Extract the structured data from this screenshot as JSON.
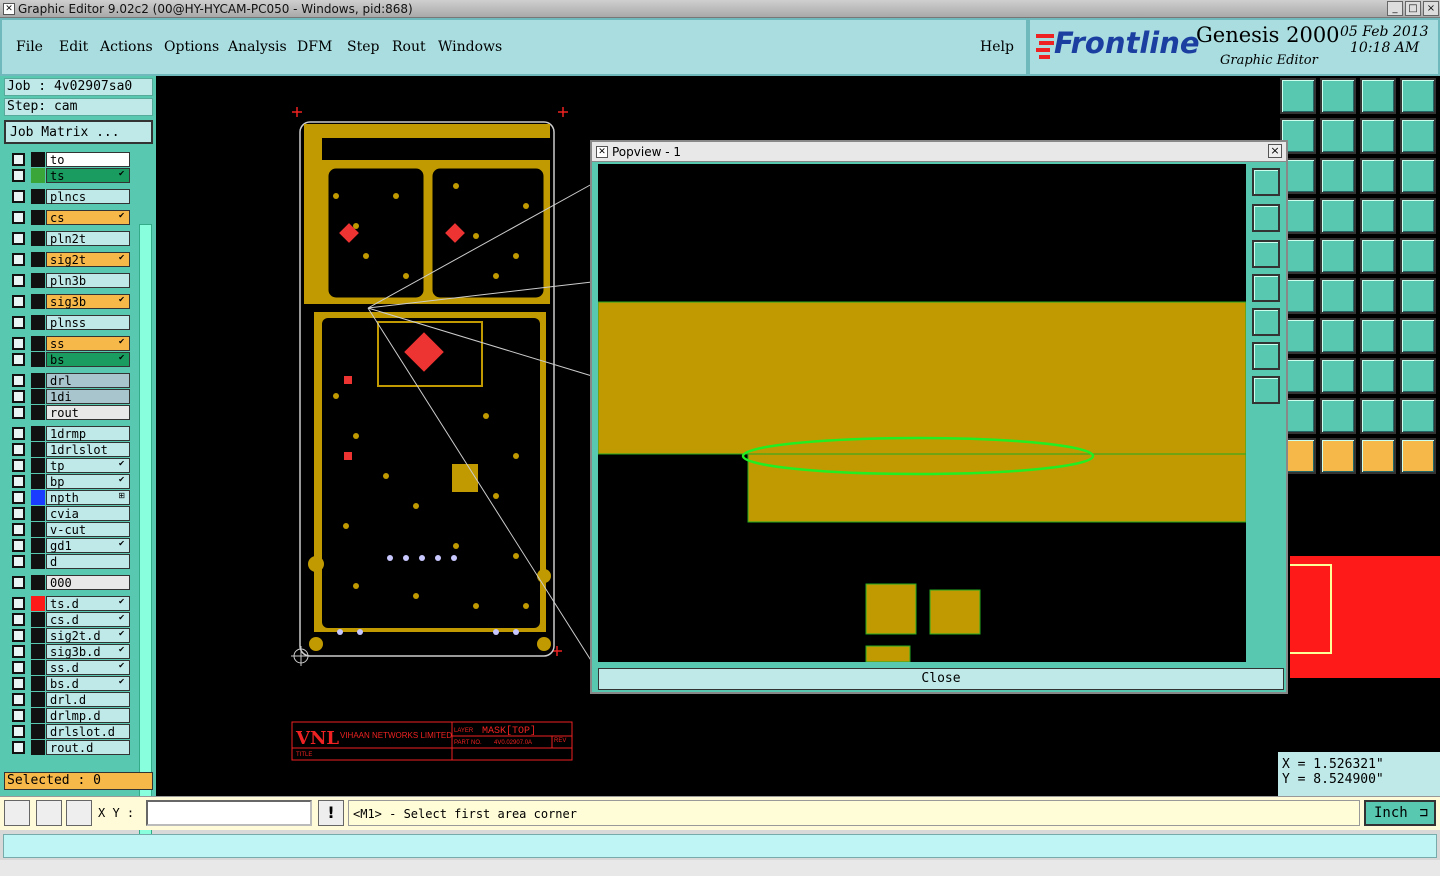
{
  "window": {
    "title": "Graphic Editor 9.02c2 (00@HY-HYCAM-PC050 - Windows, pid:868)"
  },
  "menu": {
    "items": [
      "File",
      "Edit",
      "Actions",
      "Options",
      "Analysis",
      "DFM",
      "Step",
      "Rout",
      "Windows"
    ],
    "help": "Help"
  },
  "brand": {
    "logo": "Frontline",
    "product": "Genesis 2000",
    "subtitle": "Graphic Editor",
    "date": "05 Feb 2013",
    "time": "10:18 AM"
  },
  "job": {
    "job_label": "Job : 4v02907sa0",
    "step_label": "Step: cam",
    "matrix_button": "Job Matrix ..."
  },
  "layers": [
    {
      "name": "to",
      "color": "#ffffff",
      "swatch": "#111111",
      "mark": ""
    },
    {
      "name": "ts",
      "color": "#1a9c60",
      "swatch": "#3aa63a",
      "mark": "✔"
    },
    {
      "name": "plncs",
      "color": "#bfe8e8",
      "swatch": "#111111",
      "mark": ""
    },
    {
      "name": "cs",
      "color": "#f7b84a",
      "swatch": "#111111",
      "mark": "✔"
    },
    {
      "name": "pln2t",
      "color": "#bfe8e8",
      "swatch": "#111111",
      "mark": ""
    },
    {
      "name": "sig2t",
      "color": "#f7b84a",
      "swatch": "#111111",
      "mark": "✔"
    },
    {
      "name": "pln3b",
      "color": "#bfe8e8",
      "swatch": "#111111",
      "mark": ""
    },
    {
      "name": "sig3b",
      "color": "#f7b84a",
      "swatch": "#111111",
      "mark": "✔"
    },
    {
      "name": "plnss",
      "color": "#bfe8e8",
      "swatch": "#111111",
      "mark": ""
    },
    {
      "name": "ss",
      "color": "#f7b84a",
      "swatch": "#111111",
      "mark": "✔"
    },
    {
      "name": "bs",
      "color": "#1a9c60",
      "swatch": "#111111",
      "mark": "✔"
    },
    {
      "name": "drl",
      "color": "#a8c4cc",
      "swatch": "#111111",
      "mark": ""
    },
    {
      "name": "1di",
      "color": "#a8c4cc",
      "swatch": "#111111",
      "mark": ""
    },
    {
      "name": "rout",
      "color": "#e8e8e8",
      "swatch": "#111111",
      "mark": ""
    },
    {
      "name": "1drmp",
      "color": "#bfe8e8",
      "swatch": "#111111",
      "mark": ""
    },
    {
      "name": "1drlslot",
      "color": "#bfe8e8",
      "swatch": "#111111",
      "mark": ""
    },
    {
      "name": "tp",
      "color": "#bfe8e8",
      "swatch": "#111111",
      "mark": "✔"
    },
    {
      "name": "bp",
      "color": "#bfe8e8",
      "swatch": "#111111",
      "mark": "✔"
    },
    {
      "name": "npth",
      "color": "#bfe8e8",
      "swatch": "#1a3cff",
      "mark": "⊞"
    },
    {
      "name": "cvia",
      "color": "#bfe8e8",
      "swatch": "#111111",
      "mark": ""
    },
    {
      "name": "v-cut",
      "color": "#bfe8e8",
      "swatch": "#111111",
      "mark": ""
    },
    {
      "name": "gd1",
      "color": "#bfe8e8",
      "swatch": "#111111",
      "mark": "✔"
    },
    {
      "name": "d",
      "color": "#bfe8e8",
      "swatch": "#111111",
      "mark": ""
    },
    {
      "name": "000",
      "color": "#e8e8e8",
      "swatch": "#111111",
      "mark": ""
    },
    {
      "name": "ts.d",
      "color": "#bfe8e8",
      "swatch": "#ff1a1a",
      "mark": "✔"
    },
    {
      "name": "cs.d",
      "color": "#bfe8e8",
      "swatch": "#111111",
      "mark": "✔"
    },
    {
      "name": "sig2t.d",
      "color": "#bfe8e8",
      "swatch": "#111111",
      "mark": "✔"
    },
    {
      "name": "sig3b.d",
      "color": "#bfe8e8",
      "swatch": "#111111",
      "mark": "✔"
    },
    {
      "name": "ss.d",
      "color": "#bfe8e8",
      "swatch": "#111111",
      "mark": "✔"
    },
    {
      "name": "bs.d",
      "color": "#bfe8e8",
      "swatch": "#111111",
      "mark": "✔"
    },
    {
      "name": "drl.d",
      "color": "#bfe8e8",
      "swatch": "#111111",
      "mark": ""
    },
    {
      "name": "drlmp.d",
      "color": "#bfe8e8",
      "swatch": "#111111",
      "mark": ""
    },
    {
      "name": "drlslot.d",
      "color": "#bfe8e8",
      "swatch": "#111111",
      "mark": ""
    },
    {
      "name": "rout.d",
      "color": "#bfe8e8",
      "swatch": "#111111",
      "mark": ""
    }
  ],
  "selected": "Selected : 0",
  "popview": {
    "title": "Popview - 1",
    "close_label": "Close"
  },
  "coords": {
    "x": "X = 1.526321\"",
    "y": "Y = 8.524900\""
  },
  "status": {
    "xy_label": "X Y :",
    "xy_value": "",
    "prompt": "<M1> - Select first area corner",
    "unit": "Inch"
  },
  "titleblock": {
    "company": "VIHAAN NETWORKS LIMITED",
    "layer_label": "LAYER",
    "layer_value": "MASK[TOP]",
    "part_label": "PART NO.",
    "part_value": "4V0.02907.0A",
    "rev_label": "REV",
    "title_label": "TITLE"
  },
  "colors": {
    "board": "#c09a00",
    "accent": "#58c8b0",
    "outline": "#22cc22"
  }
}
